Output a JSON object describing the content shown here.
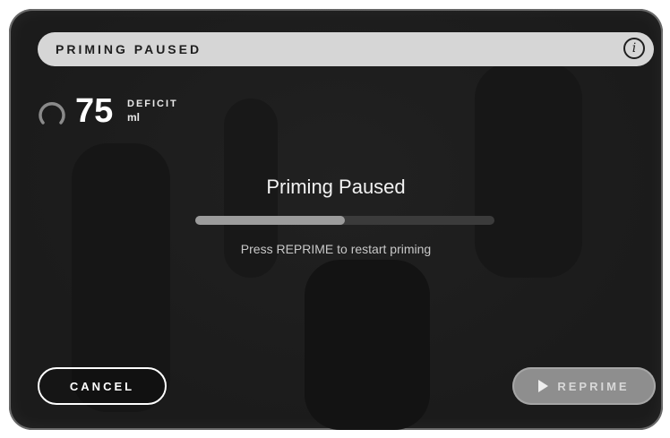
{
  "header": {
    "title": "PRIMING PAUSED",
    "info_icon": "info-icon",
    "info_glyph": "i"
  },
  "deficit": {
    "value": "75",
    "label": "DEFICIT",
    "unit": "ml",
    "ring_icon": "deficit-ring-icon"
  },
  "status": {
    "title": "Priming Paused",
    "hint": "Press REPRIME to restart priming",
    "progress_fraction": 0.5
  },
  "actions": {
    "cancel_label": "CANCEL",
    "reprime_label": "REPRIME",
    "reprime_icon": "play-icon"
  },
  "colors": {
    "background": "#1b1b1b",
    "header_bar": "#d6d6d6",
    "progress_track": "#3b3b3b",
    "progress_fill": "#9c9c9c",
    "reprime_button": "#8e8e8e"
  }
}
